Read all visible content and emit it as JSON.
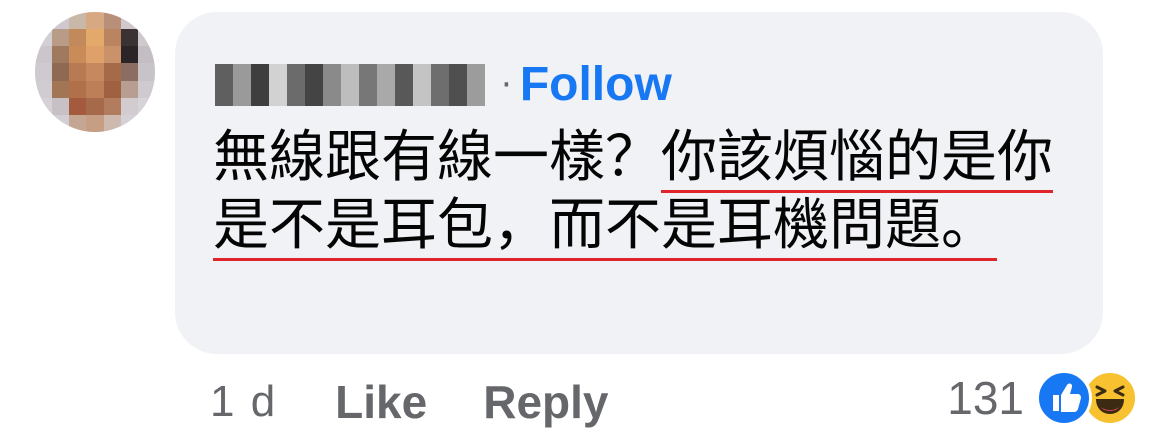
{
  "comment": {
    "author_name": "",
    "separator": "·",
    "follow_label": "Follow",
    "text_plain": "無線跟有線一樣？",
    "text_highlighted": "你該煩惱的是你是不是耳包，而不是耳機問題。"
  },
  "actions": {
    "time": "1 d",
    "like_label": "Like",
    "reply_label": "Reply"
  },
  "reactions": {
    "count": "131",
    "icons": [
      "like-icon",
      "haha-icon"
    ]
  },
  "colors": {
    "follow": "#1877f2",
    "bubble": "#f0f2f5",
    "meta": "#65676b",
    "underline": "#e0242b",
    "like": "#1877f2",
    "haha": "#f7c12f"
  }
}
